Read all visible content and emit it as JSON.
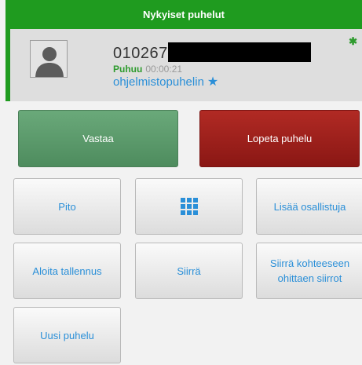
{
  "header": {
    "title": "Nykyiset puhelut"
  },
  "call": {
    "number": "010267",
    "state": "Puhuu",
    "duration": "00:00:21",
    "channel": "ohjelmistopuhelin",
    "channel_icon": "star-icon",
    "sync_icon": "asterisk-icon"
  },
  "actions": {
    "answer": "Vastaa",
    "hangup": "Lopeta puhelu",
    "hold": "Pito",
    "keypad_icon": "keypad-icon",
    "add_participant": "Lisää osallistuja",
    "start_recording": "Aloita tallennus",
    "transfer": "Siirrä",
    "transfer_bypass": "Siirrä kohteeseen ohittaen siirrot",
    "new_call": "Uusi puhelu"
  },
  "colors": {
    "header": "#1f9b1f",
    "answer": "#5a9a6a",
    "hangup": "#9e1f1b",
    "link": "#2a8fd8"
  }
}
